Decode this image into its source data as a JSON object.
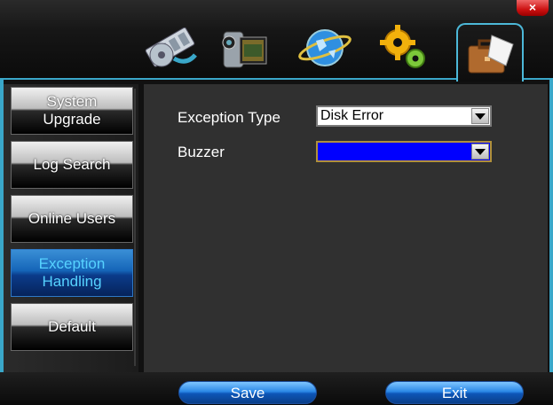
{
  "window": {
    "close_glyph": "×"
  },
  "tabs": [
    {
      "icon": "film-reel-icon"
    },
    {
      "icon": "camcorder-icon"
    },
    {
      "icon": "network-globe-icon"
    },
    {
      "icon": "gears-icon"
    },
    {
      "icon": "toolbox-icon",
      "active": true
    }
  ],
  "menu": {
    "items": [
      {
        "label": "System Upgrade"
      },
      {
        "label": "Log Search"
      },
      {
        "label": "Online Users"
      },
      {
        "label": "Exception Handling",
        "active": true
      },
      {
        "label": "Default"
      }
    ]
  },
  "form": {
    "exception_type_label": "Exception Type",
    "exception_type_value": "Disk Error",
    "buzzer_label": "Buzzer",
    "buzzer_value": ""
  },
  "buttons": {
    "save": "Save",
    "exit": "Exit"
  },
  "colors": {
    "accent": "#3aa7c9",
    "active_menu": "#1565b8",
    "active_text": "#56d2ff",
    "buzzer_fill": "#0000ff"
  }
}
